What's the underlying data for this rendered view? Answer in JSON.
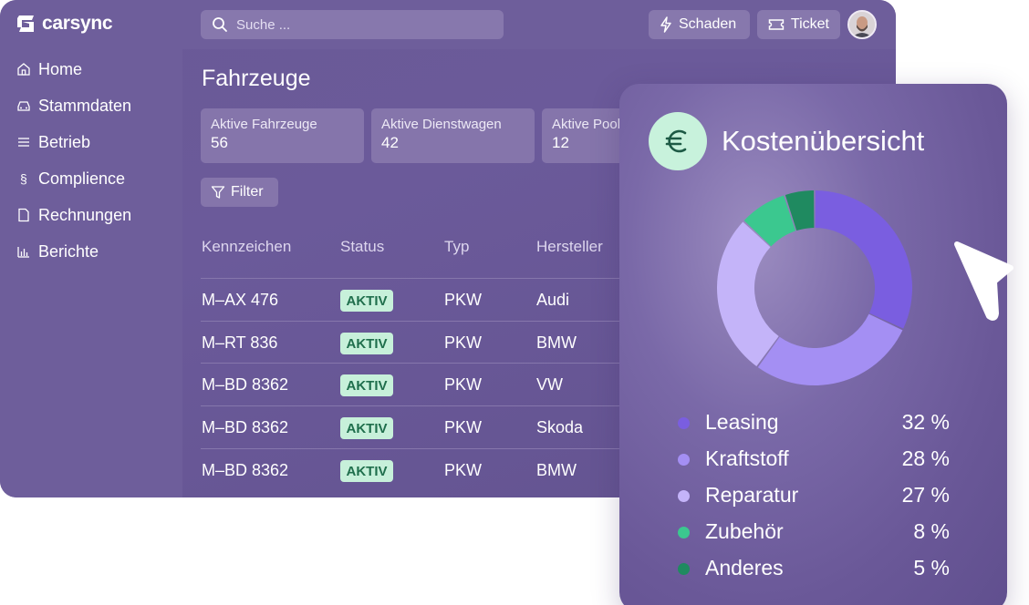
{
  "app": {
    "brand": "carsync",
    "search": {
      "placeholder": "Suche ..."
    },
    "header_buttons": {
      "schaden": "Schaden",
      "ticket": "Ticket"
    },
    "sidebar": {
      "items": [
        {
          "label": "Home",
          "icon": "home-icon"
        },
        {
          "label": "Stammdaten",
          "icon": "car-icon"
        },
        {
          "label": "Betrieb",
          "icon": "list-icon"
        },
        {
          "label": "Complience",
          "icon": "paragraph-icon"
        },
        {
          "label": "Rechnungen",
          "icon": "document-icon"
        },
        {
          "label": "Berichte",
          "icon": "bar-chart-icon"
        }
      ]
    },
    "page_title": "Fahrzeuge",
    "stats": [
      {
        "label": "Aktive Fahrzeuge",
        "value": "56"
      },
      {
        "label": "Aktive Dienstwagen",
        "value": "42"
      },
      {
        "label": "Aktive Pool",
        "value": "12"
      }
    ],
    "filter_label": "Filter",
    "table": {
      "columns": [
        "Kennzeichen",
        "Status",
        "Typ",
        "Hersteller"
      ],
      "rows": [
        {
          "plate": "M–AX 476",
          "status": "AKTIV",
          "type": "PKW",
          "maker": "Audi"
        },
        {
          "plate": "M–RT 836",
          "status": "AKTIV",
          "type": "PKW",
          "maker": "BMW"
        },
        {
          "plate": "M–BD 8362",
          "status": "AKTIV",
          "type": "PKW",
          "maker": "VW"
        },
        {
          "plate": "M–BD 8362",
          "status": "AKTIV",
          "type": "PKW",
          "maker": "Skoda"
        },
        {
          "plate": "M–BD 8362",
          "status": "AKTIV",
          "type": "PKW",
          "maker": "BMW"
        }
      ]
    }
  },
  "cost_card": {
    "icon": "euro-icon",
    "title": "Kostenübersicht",
    "legend": [
      {
        "name": "Leasing",
        "value": "32 %",
        "color": "#7a5ee0"
      },
      {
        "name": "Kraftstoff",
        "value": "28 %",
        "color": "#a48ff3"
      },
      {
        "name": "Reparatur",
        "value": "27 %",
        "color": "#c4b4f9"
      },
      {
        "name": "Zubehör",
        "value": "8 %",
        "color": "#3bc88f"
      },
      {
        "name": "Anderes",
        "value": "5 %",
        "color": "#1f8a60"
      }
    ]
  },
  "chart_data": {
    "type": "pie",
    "title": "Kostenübersicht",
    "categories": [
      "Leasing",
      "Kraftstoff",
      "Reparatur",
      "Zubehör",
      "Anderes"
    ],
    "values": [
      32,
      28,
      27,
      8,
      5
    ],
    "colors": [
      "#7a5ee0",
      "#a48ff3",
      "#c4b4f9",
      "#3bc88f",
      "#1f8a60"
    ],
    "legend": "bottom"
  }
}
